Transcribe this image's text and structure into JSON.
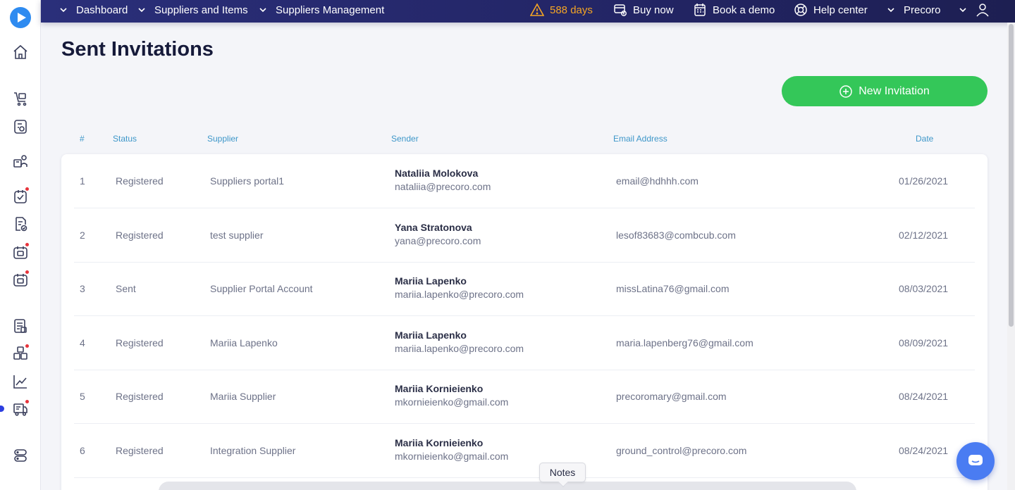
{
  "topbar": {
    "breadcrumbs": [
      "Dashboard",
      "Suppliers and Items",
      "Suppliers Management"
    ],
    "trial_days": "588 days",
    "buy_now": "Buy now",
    "book_demo": "Book a demo",
    "help_center": "Help center",
    "company": "Precoro"
  },
  "page": {
    "title": "Sent Invitations",
    "new_button": "New Invitation"
  },
  "table": {
    "headers": [
      "#",
      "Status",
      "Supplier",
      "Sender",
      "Email Address",
      "Date"
    ],
    "rows": [
      {
        "num": "1",
        "status": "Registered",
        "supplier": "Suppliers portal1",
        "sender_name": "Nataliia Molokova",
        "sender_email": "nataliia@precoro.com",
        "email": "email@hdhhh.com",
        "date": "01/26/2021"
      },
      {
        "num": "2",
        "status": "Registered",
        "supplier": "test supplier",
        "sender_name": "Yana Stratonova",
        "sender_email": "yana@precoro.com",
        "email": "lesof83683@combcub.com",
        "date": "02/12/2021"
      },
      {
        "num": "3",
        "status": "Sent",
        "supplier": "Supplier Portal Account",
        "sender_name": "Mariia Lapenko",
        "sender_email": "mariia.lapenko@precoro.com",
        "email": "missLatina76@gmail.com",
        "date": "08/03/2021"
      },
      {
        "num": "4",
        "status": "Registered",
        "supplier": "Mariia Lapenko",
        "sender_name": "Mariia Lapenko",
        "sender_email": "mariia.lapenko@precoro.com",
        "email": "maria.lapenberg76@gmail.com",
        "date": "08/09/2021"
      },
      {
        "num": "5",
        "status": "Registered",
        "supplier": "Mariia Supplier",
        "sender_name": "Mariia Kornieienko",
        "sender_email": "mkornieienko@gmail.com",
        "email": "precoromary@gmail.com",
        "date": "08/24/2021"
      },
      {
        "num": "6",
        "status": "Registered",
        "supplier": "Integration Supplier",
        "sender_name": "Mariia Kornieienko",
        "sender_email": "mkornieienko@gmail.com",
        "email": "ground_control@precoro.com",
        "date": "08/24/2021"
      }
    ]
  },
  "notes_label": "Notes",
  "colors": {
    "primary_button": "#34c759",
    "header_text": "#3e97c9",
    "topbar": "#232565",
    "warning": "#f5a524",
    "notification_dot": "#e8343c"
  },
  "icons": {
    "sidebar": [
      "home-icon",
      "cart-icon",
      "requests-icon",
      "suppliers-icon",
      "tasks-icon",
      "documents-icon",
      "invoice-icon",
      "receipt-icon",
      "catalog-icon",
      "items-icon",
      "reports-icon",
      "supplier-management-icon",
      "database-icon"
    ],
    "topbar": [
      "warning-icon",
      "buy-icon",
      "demo-icon",
      "help-icon",
      "user-icon"
    ]
  }
}
